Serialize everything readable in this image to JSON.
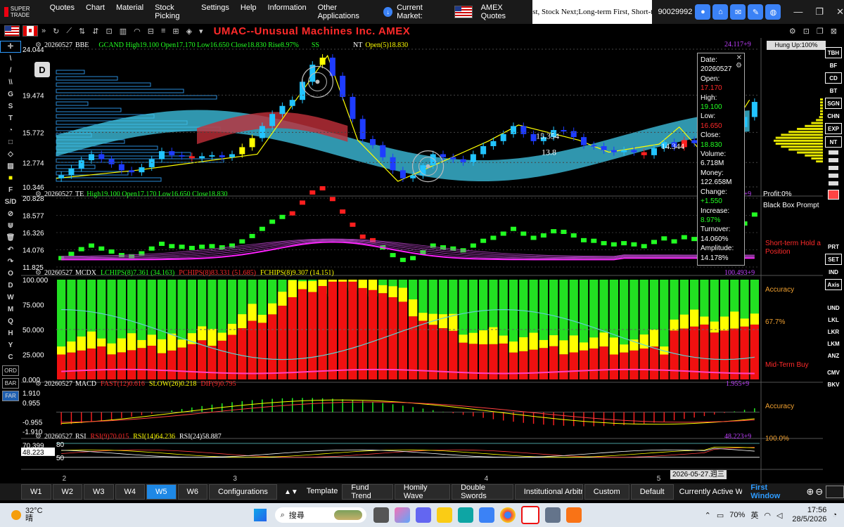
{
  "app": {
    "logo_text": "SUPER TRADE"
  },
  "menu": [
    "Quotes",
    "Chart",
    "Material",
    "Stock Picking",
    "Settings",
    "Help",
    "Information",
    "Other Applications"
  ],
  "market": {
    "label": "Current Market:",
    "quotes_label": "AMEX Quotes",
    "ticker": "st, Stock Next;Long-term First, Short-term",
    "account": "90029992"
  },
  "title": "UMAC--Unusual Machines Inc.  AMEX",
  "hung_up": "Hung Up:100%",
  "panels": {
    "main": {
      "date": "20260527",
      "name": "BBE",
      "line": "GCAND High19.100 Open17.170 Low16.650 Close18.830 Rise8.97%",
      "ss": "SS",
      "nt": "NT",
      "nt_val": "Open(5)18.830",
      "right_val": "24.117+9",
      "yticks": [
        "24.044",
        "19.474",
        "15.772",
        "12.774",
        "10.346"
      ],
      "level1": "15.354",
      "level2": "13.8",
      "level3": "14.344",
      "marker": "D"
    },
    "te": {
      "date": "20260527",
      "name": "TE",
      "line": "High19.100 Open17.170 Low16.650 Close18.830",
      "right_val": "20.894+9",
      "yticks": [
        "20.828",
        "18.577",
        "16.326",
        "14.076",
        "11.825"
      ],
      "note1": "Profit:0%",
      "note2": "Black Box Prompt",
      "note3": "Short-term Hold a Position"
    },
    "mcdx": {
      "date": "20260527",
      "name": "MCDX",
      "l1": "LCHIPS(8)7.361 (34.163)",
      "l2": "PCHIPS(8)83.331 (51.685)",
      "l3": "FCHIPS(8)9.307 (14.151)",
      "right_val": "100.493+9",
      "yticks": [
        "100.000",
        "75.000",
        "50.000",
        "25.000",
        "0.000"
      ],
      "note1": "Accuracy",
      "note2": "67.7%",
      "note3": "Mid-Term Buy"
    },
    "macd": {
      "date": "20260527",
      "name": "MACD",
      "fast": "FAST(12)0.616",
      "slow": "SLOW(26)0.218",
      "dif": "DIF(9)0.795",
      "right_val": "1.955+9",
      "yticks": [
        "1.910",
        "0.955",
        "-0.955",
        "-1.910"
      ],
      "note": "Accuracy"
    },
    "rsi": {
      "date": "20260527",
      "name": "RSI",
      "r9": "RSI(9)70.015",
      "r14": "RSI(14)64.236",
      "r24": "RSI(24)58.887",
      "right_val": "48.223+9",
      "yticks": [
        "70.399",
        "48.223",
        "80",
        "50"
      ],
      "note": "100.0%"
    }
  },
  "xaxis": [
    "2",
    "3",
    "4",
    "5"
  ],
  "date_label": "2026-05-27.週三",
  "infobox": {
    "date_lbl": "Date:",
    "date": "20260527",
    "open_lbl": "Open:",
    "open": "17.170",
    "high_lbl": "High:",
    "high": "19.100",
    "low_lbl": "Low:",
    "low": "16.650",
    "close_lbl": "Close:",
    "close": "18.830",
    "volume_lbl": "Volume:",
    "volume": "6.718M",
    "money_lbl": "Money:",
    "money": "122.658M",
    "change_lbl": "Change:",
    "change": "+1.550",
    "increase_lbl": "Increase:",
    "increase": "8.97%",
    "turnover_lbl": "Turnover:",
    "turnover": "14.060%",
    "amplitude_lbl": "Amplitude:",
    "amplitude": "14.178%"
  },
  "left_tools": [
    "✛",
    "\\",
    "/",
    "\\\\",
    "G",
    "S",
    "T",
    "◔",
    "□",
    "◇",
    "▨",
    "■",
    "F",
    "S/D",
    "⊘",
    "⋓",
    "🗑",
    "↶",
    "↷",
    "O",
    "D",
    "W",
    "M",
    "Q",
    "H",
    "Y",
    "C"
  ],
  "left_btns": [
    "ORD",
    "BAR",
    "FAR"
  ],
  "right_btns": [
    "TBH",
    "BF",
    "CD",
    "BT",
    "SGN",
    "CHN",
    "EXP",
    "NT",
    "PRT",
    "SET",
    "IND",
    "Axis",
    "UND",
    "LKL",
    "LKR",
    "LKM",
    "ANZ",
    "CMV",
    "BKV"
  ],
  "bottom_tabs": [
    "W1",
    "W2",
    "W3",
    "W4",
    "W5",
    "W6",
    "Configurations"
  ],
  "bottom_active": "W5",
  "bottom_right": [
    "Template",
    "Fund Trend",
    "Homily Wave",
    "Double Swords",
    "Institutional Arbitra",
    "Custom",
    "Default"
  ],
  "bottom_status": "Currently Active Winc",
  "first_window": "First Window",
  "taskbar": {
    "temp": "32°C",
    "weather": "晴",
    "search": "搜尋",
    "battery": "70%",
    "lang": "英",
    "time": "17:56",
    "date": "28/5/2026"
  },
  "colors": {
    "bull": "#22c4ff",
    "bear": "#ff1f1f",
    "yellow": "#ffff00",
    "green": "#22ff22",
    "magenta": "#ff22ff",
    "accent": "#1e88e5"
  }
}
